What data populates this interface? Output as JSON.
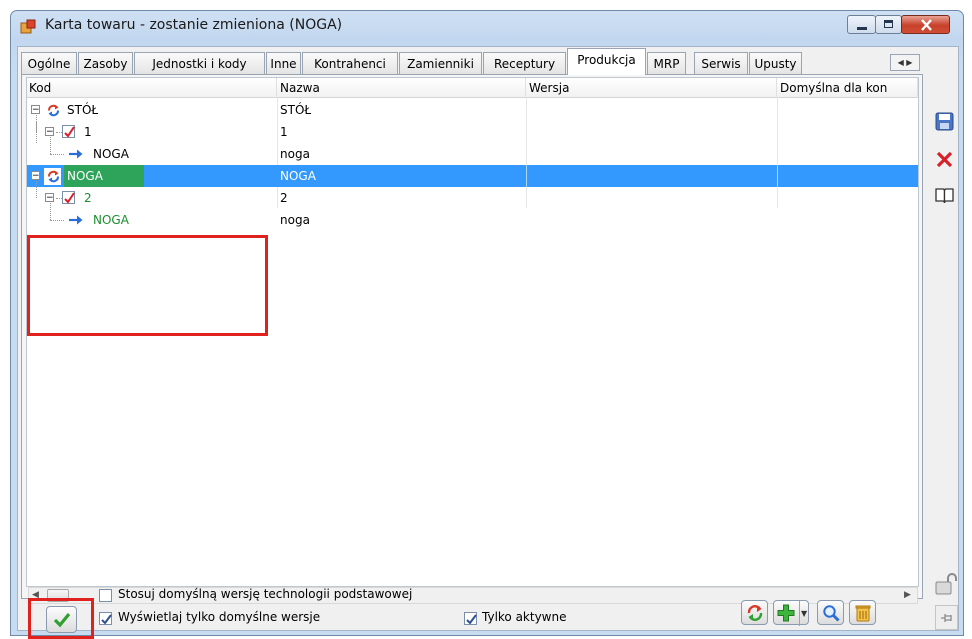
{
  "window": {
    "title": "Karta towaru - zostanie zmieniona (NOGA)"
  },
  "tabs": [
    {
      "label": "Ogólne"
    },
    {
      "label": "Zasoby"
    },
    {
      "label": "Jednostki i kody"
    },
    {
      "label": "Inne"
    },
    {
      "label": "Kontrahenci"
    },
    {
      "label": "Zamienniki"
    },
    {
      "label": "Receptury"
    },
    {
      "label": "Produkcja",
      "active": true
    },
    {
      "label": "MRP"
    },
    {
      "label": "Serwis"
    },
    {
      "label": "Upusty"
    }
  ],
  "grid": {
    "columns": [
      "Kod",
      "Nazwa",
      "Wersja",
      "Domyślna dla kon"
    ],
    "rows": [
      {
        "kod": "STÓŁ",
        "nazwa": "STÓŁ",
        "icon": "recycle-icon",
        "level": 0,
        "expander": "−"
      },
      {
        "kod": "1",
        "nazwa": "1",
        "icon": "checkmark-icon",
        "level": 1,
        "expander": "−"
      },
      {
        "kod": "NOGA",
        "nazwa": "noga",
        "icon": "arrow-right-icon",
        "level": 2
      },
      {
        "kod": "NOGA",
        "nazwa": "NOGA",
        "icon": "recycle-icon",
        "level": 0,
        "expander": "−",
        "selected": true
      },
      {
        "kod": "2",
        "nazwa": "2",
        "icon": "checkmark-icon",
        "level": 1,
        "expander": "−",
        "green": true
      },
      {
        "kod": "NOGA",
        "nazwa": "noga",
        "icon": "arrow-right-icon",
        "level": 2,
        "green": true
      }
    ]
  },
  "options": {
    "use_default_version": {
      "label": "Stosuj domyślną wersję technologii podstawowej",
      "checked": false
    },
    "show_default_only": {
      "label": "Wyświetlaj tylko domyślne wersje",
      "checked": true
    },
    "only_active": {
      "label": "Tylko aktywne",
      "checked": true
    }
  },
  "colors": {
    "selection": "#3399ff",
    "highlight_box": "#e0221f",
    "green_text": "#1a8f2c"
  }
}
